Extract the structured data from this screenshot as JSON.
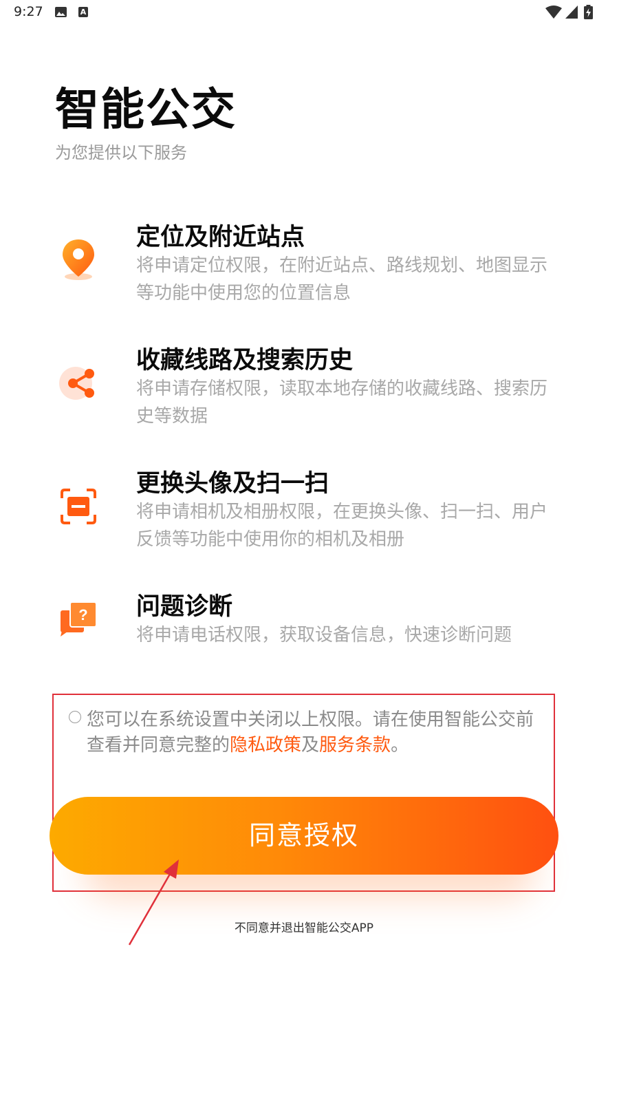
{
  "status_bar": {
    "time": "9:27",
    "icons": [
      "image-icon",
      "a-box-icon",
      "wifi-icon",
      "signal-icon",
      "battery-icon"
    ]
  },
  "header": {
    "title": "智能公交",
    "subtitle": "为您提供以下服务"
  },
  "permissions": [
    {
      "icon": "location-pin-icon",
      "title": "定位及附近站点",
      "desc": "将申请定位权限，在附近站点、路线规划、地图显示等功能中使用您的位置信息"
    },
    {
      "icon": "share-icon",
      "title": "收藏线路及搜索历史",
      "desc": "将申请存储权限，读取本地存储的收藏线路、搜索历史等数据"
    },
    {
      "icon": "scan-icon",
      "title": "更换头像及扫一扫",
      "desc": "将申请相机及相册权限，在更换头像、扫一扫、用户反馈等功能中使用你的相机及相册"
    },
    {
      "icon": "question-chat-icon",
      "title": "问题诊断",
      "desc": "将申请电话权限，获取设备信息，快速诊断问题"
    }
  ],
  "consent": {
    "text_before": "您可以在系统设置中关闭以上权限。请在使用智能公交前查看并同意完整的",
    "privacy_link": "隐私政策",
    "conjunction": "及",
    "terms_link": "服务条款",
    "text_after": "。"
  },
  "actions": {
    "agree_label": "同意授权",
    "decline_label": "不同意并退出智能公交APP"
  },
  "colors": {
    "accent": "#ff5a10",
    "button_gradient_start": "#fdaa00",
    "button_gradient_end": "#ff5010",
    "annotation": "#e0303a"
  }
}
